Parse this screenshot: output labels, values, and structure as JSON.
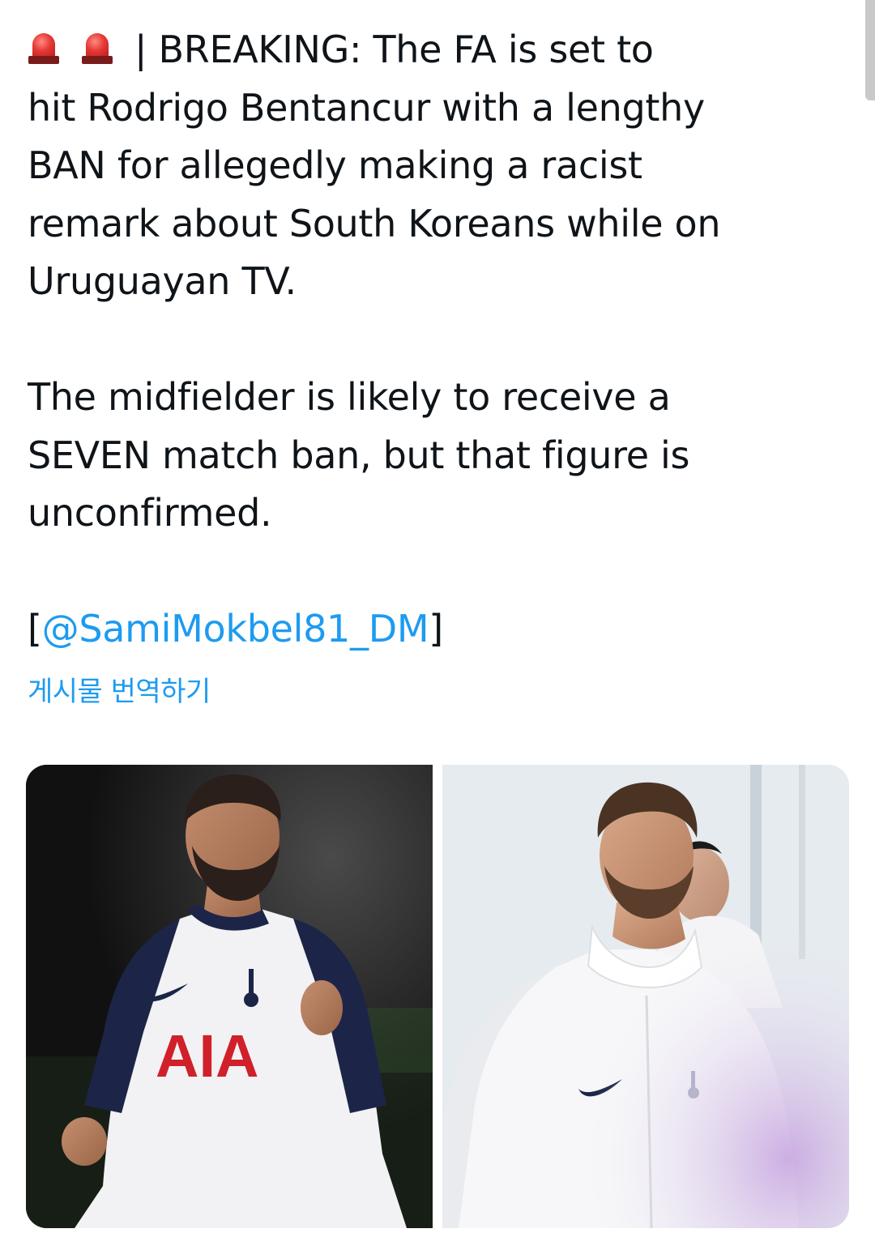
{
  "tweet": {
    "lines": [
      "| BREAKING: The FA is set to",
      "hit Rodrigo Bentancur with a lengthy",
      "BAN for allegedly making a racist",
      "remark about South Koreans while on",
      "Uruguayan TV.",
      "The midfielder is likely to receive a",
      "SEVEN match ban, but that figure is",
      "unconfirmed."
    ],
    "mention_open": "[",
    "mention": "@SamiMokbel81_DM",
    "mention_close": "]",
    "lead_icon": "police-siren-emoji"
  },
  "translate_label": "게시물 번역하기",
  "media": {
    "photo_left": {
      "subject": "player-in-white-and-navy-home-kit",
      "shirt_text": "AIA"
    },
    "photo_right": {
      "subject": "player-in-white-training-jacket"
    }
  },
  "colors": {
    "text": "#0f1419",
    "link": "#1d9bf0",
    "background": "#ffffff",
    "sponsor_red": "#d0202a",
    "kit_navy": "#1c2548"
  }
}
